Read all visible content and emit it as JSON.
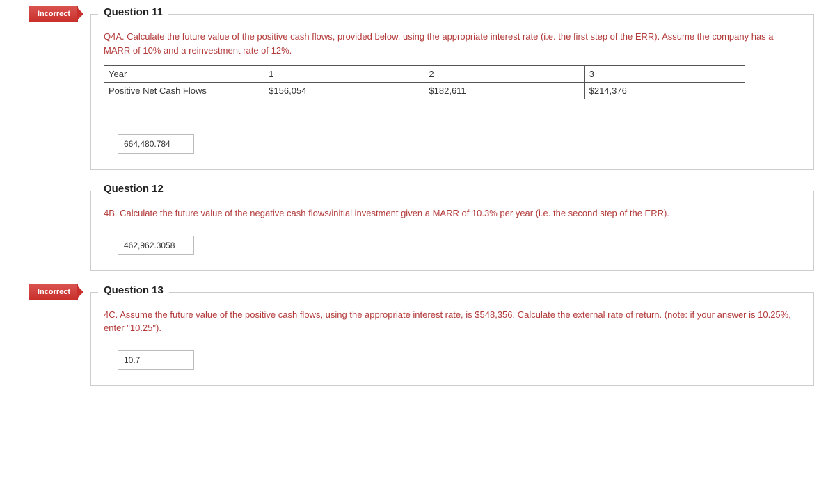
{
  "badges": {
    "incorrect": "Incorrect"
  },
  "q11": {
    "title": "Question 11",
    "prompt": "Q4A. Calculate the future value of the positive cash flows, provided below, using the appropriate interest rate (i.e. the first step of the ERR). Assume the company has a MARR of 10% and a reinvestment rate of 12%.",
    "table": {
      "row1": {
        "c0": "Year",
        "c1": "1",
        "c2": "2",
        "c3": "3"
      },
      "row2": {
        "c0": "Positive Net Cash Flows",
        "c1": "$156,054",
        "c2": "$182,611",
        "c3": "$214,376"
      }
    },
    "answer": "664,480.784"
  },
  "q12": {
    "title": "Question 12",
    "prompt": "4B. Calculate the future value of the negative cash flows/initial investment given a MARR of 10.3% per year (i.e. the second step of the ERR).",
    "answer": "462,962.3058"
  },
  "q13": {
    "title": "Question 13",
    "prompt": "4C. Assume the future value of the positive cash flows, using the appropriate interest rate, is $548,356. Calculate the external rate of return. (note: if your answer is 10.25%, enter \"10.25\").",
    "answer": "10.7"
  }
}
